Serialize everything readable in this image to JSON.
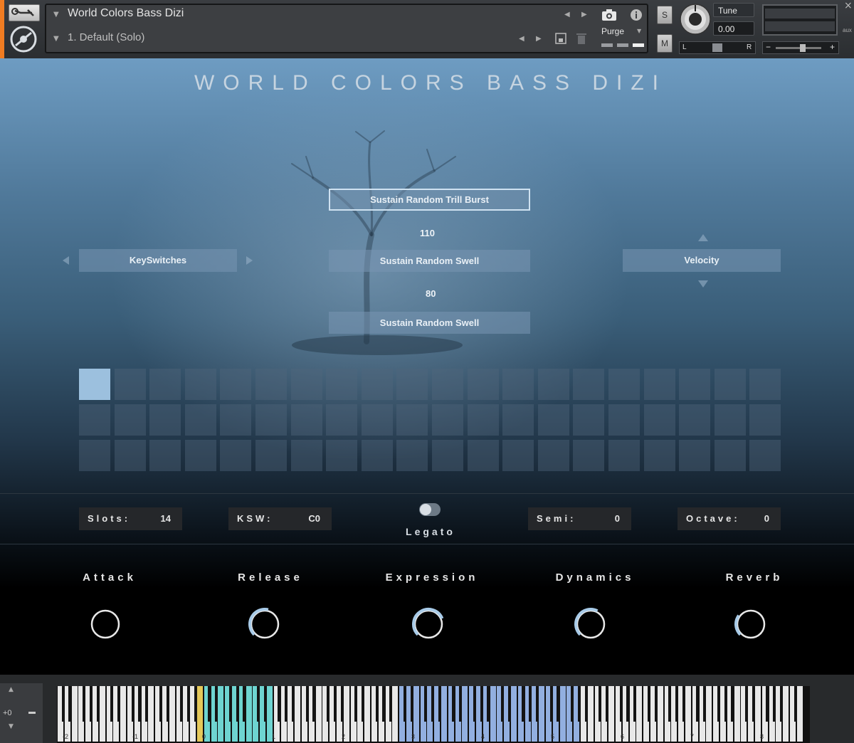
{
  "header": {
    "instrument_name": "World Colors Bass Dizi",
    "preset_name": "1. Default (Solo)",
    "purge_label": "Purge",
    "solo_label": "S",
    "mute_label": "M",
    "tune_label": "Tune",
    "tune_value": "0.00",
    "pan_left": "L",
    "pan_right": "R",
    "vol_minus": "−",
    "vol_plus": "+",
    "close_glyph": "×",
    "aux_label": "aux"
  },
  "main": {
    "title": "WORLD COLORS BASS DIZI",
    "articulations": [
      {
        "label": "Sustain Random Trill Burst",
        "active": true
      },
      {
        "label": "Sustain Random Swell"
      },
      {
        "label": "Sustain Random Swell"
      }
    ],
    "velocity_splits": [
      "110",
      "80"
    ],
    "left_selector": "KeySwitches",
    "right_selector": "Velocity",
    "grid": {
      "rows": 3,
      "cols": 20,
      "selected_index": 0
    },
    "fields": {
      "slots_label": "Slots:",
      "slots_value": "14",
      "ksw_label": "KSW:",
      "ksw_value": "C0",
      "semi_label": "Semi:",
      "semi_value": "0",
      "octave_label": "Octave:",
      "octave_value": "0"
    },
    "legato_label": "Legato",
    "knobs": [
      {
        "label": "Attack",
        "value": 0.0
      },
      {
        "label": "Release",
        "value": 0.55
      },
      {
        "label": "Expression",
        "value": 0.75
      },
      {
        "label": "Dynamics",
        "value": 0.6
      },
      {
        "label": "Reverb",
        "value": 0.3
      }
    ],
    "accent_color": "#a8cbe8"
  },
  "keyboard": {
    "octave_labels": [
      "-2",
      "-1",
      "0",
      "1",
      "2",
      "3",
      "4",
      "5",
      "6",
      "7",
      "8"
    ],
    "transpose": "+0",
    "keyswitch_color": "#6ed4d1",
    "playable_color": "#92afe0",
    "marker_color": "#e4c85a"
  }
}
